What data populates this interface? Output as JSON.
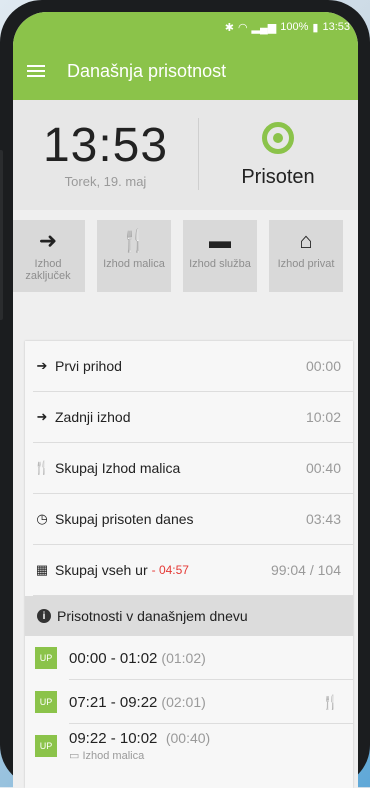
{
  "status_bar": {
    "icons": [
      "bluetooth-icon",
      "wifi-icon",
      "signal-icon"
    ],
    "battery": "100%",
    "time": "13:53"
  },
  "app_bar": {
    "title": "Današnja prisotnost"
  },
  "summary": {
    "time": "13:53",
    "date": "Torek, 19. maj",
    "status": "Prisoten",
    "status_color": "#8bc34a"
  },
  "actions": [
    {
      "icon": "exit-icon",
      "label": "Izhod zaključek"
    },
    {
      "icon": "cutlery-icon",
      "label": "Izhod malica"
    },
    {
      "icon": "briefcase-icon",
      "label": "Izhod služba"
    },
    {
      "icon": "home-icon",
      "label": "Izhod privat"
    }
  ],
  "stats": [
    {
      "icon": "arrival-icon",
      "label": "Prvi prihod",
      "value": "00:00"
    },
    {
      "icon": "exit-icon",
      "label": "Zadnji izhod",
      "value": "10:02"
    },
    {
      "icon": "cutlery-icon",
      "label": "Skupaj Izhod malica",
      "value": "00:40"
    },
    {
      "icon": "clock-icon",
      "label": "Skupaj prisoten danes",
      "value": "03:43"
    },
    {
      "icon": "calculator-icon",
      "label": "Skupaj vseh ur",
      "diff": "- 04:57",
      "value": "99:04 / 104"
    }
  ],
  "section_title": "Prisotnosti v današnjem dnevu",
  "entries": [
    {
      "tag": "UP",
      "time": "00:00 - 01:02",
      "duration": "(01:02)"
    },
    {
      "tag": "UP",
      "time": "07:21 - 09:22",
      "duration": "(02:01)",
      "trail_icon": "cutlery-icon"
    },
    {
      "tag": "UP",
      "time": "09:22 - 10:02",
      "duration": "(00:40)",
      "note": "Izhod malica"
    }
  ]
}
